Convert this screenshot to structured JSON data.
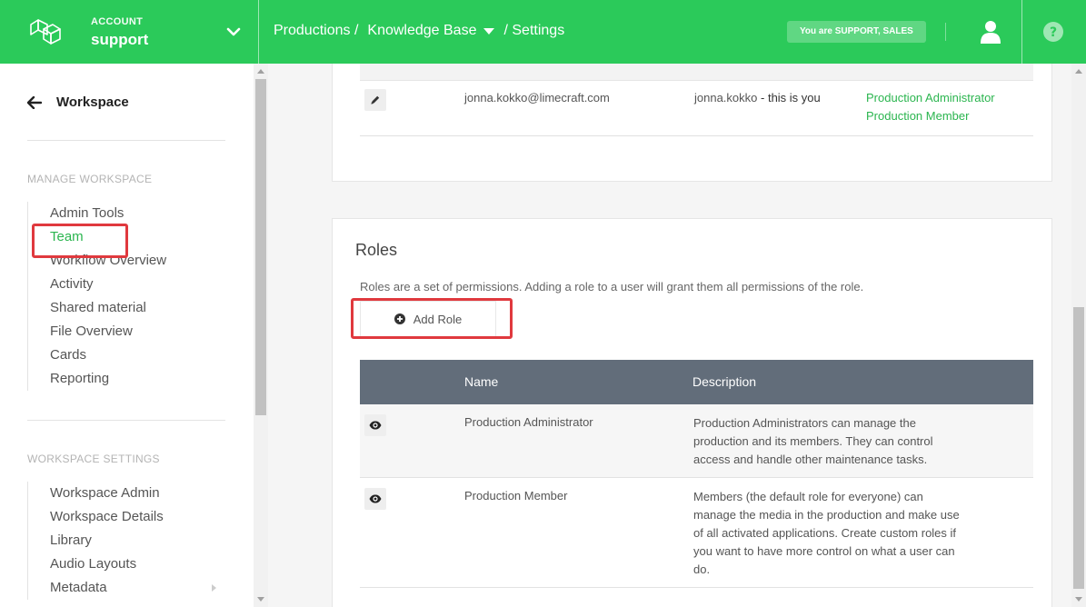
{
  "header": {
    "account_label": "ACCOUNT",
    "account_name": "support",
    "breadcrumbs": [
      "Productions /",
      "Knowledge Base",
      "/ Settings"
    ],
    "role_badge": "You are SUPPORT, SALES",
    "brand_color": "#2bca5a"
  },
  "sidebar": {
    "back_label": "Workspace",
    "manage_title": "MANAGE WORKSPACE",
    "manage_items": [
      "Admin Tools",
      "Team",
      "Workflow Overview",
      "Activity",
      "Shared material",
      "File Overview",
      "Cards",
      "Reporting"
    ],
    "settings_title": "WORKSPACE SETTINGS",
    "settings_items": [
      "Workspace Admin",
      "Workspace Details",
      "Library",
      "Audio Layouts",
      "Metadata"
    ]
  },
  "team": {
    "row": {
      "email": "jonna.kokko@limecraft.com",
      "user": "jonna.kokko",
      "you_suffix": "- this is you",
      "roles": [
        "Production Administrator",
        "Production Member"
      ]
    }
  },
  "roles": {
    "title": "Roles",
    "description": "Roles are a set of permissions. Adding a role to a user will grant them all permissions of the role.",
    "add_label": "Add Role",
    "columns": [
      "Name",
      "Description"
    ],
    "rows": [
      {
        "name": "Production Administrator",
        "description": "Production Administrators can manage the production and its members. They can control access and handle other maintenance tasks."
      },
      {
        "name": "Production Member",
        "description": "Members (the default role for everyone) can manage the media in the production and make use of all activated applications. Create custom roles if you want to have more control on what a user can do."
      }
    ]
  }
}
